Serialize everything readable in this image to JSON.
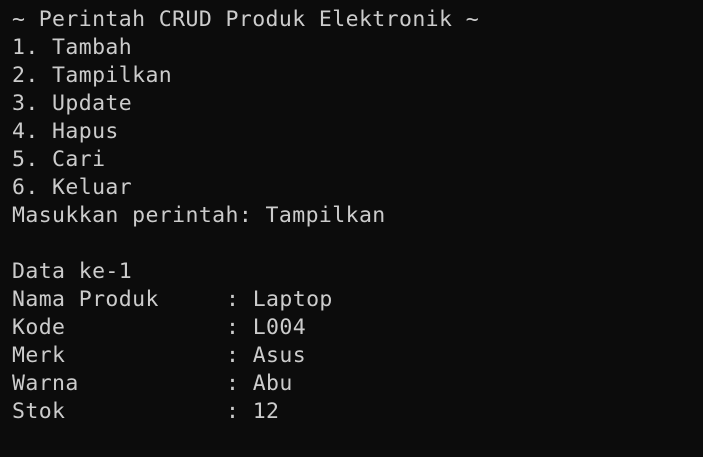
{
  "menu": {
    "title": "~ Perintah CRUD Produk Elektronik ~",
    "items": [
      "1. Tambah",
      "2. Tampilkan",
      "3. Update",
      "4. Hapus",
      "5. Cari",
      "6. Keluar"
    ]
  },
  "prompt": {
    "text": "Masukkan perintah: ",
    "input": "Tampilkan"
  },
  "result": {
    "header": "Data ke-1",
    "fields": [
      {
        "label": "Nama Produk",
        "sep": ": ",
        "value": "Laptop"
      },
      {
        "label": "Kode",
        "sep": ": ",
        "value": "L004"
      },
      {
        "label": "Merk",
        "sep": ": ",
        "value": "Asus"
      },
      {
        "label": "Warna",
        "sep": ": ",
        "value": "Abu"
      },
      {
        "label": "Stok",
        "sep": ": ",
        "value": "12"
      }
    ]
  },
  "colors": {
    "background": "#0c0c0c",
    "foreground": "#cccccc"
  }
}
